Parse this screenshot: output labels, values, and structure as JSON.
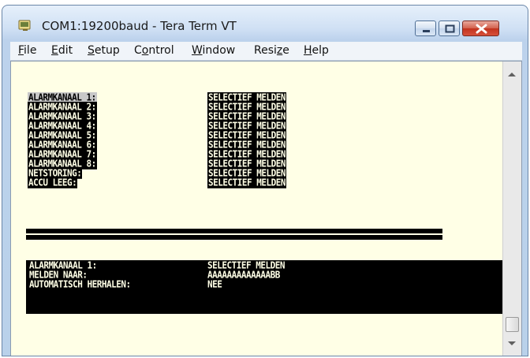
{
  "window": {
    "title": "COM1:19200baud - Tera Term VT",
    "icon": "tera-term-icon",
    "controls": [
      "minimize-icon",
      "maximize-icon",
      "close-icon"
    ]
  },
  "menu": [
    {
      "pre": "",
      "ul": "F",
      "post": "ile"
    },
    {
      "pre": "",
      "ul": "E",
      "post": "dit"
    },
    {
      "pre": "",
      "ul": "S",
      "post": "etup"
    },
    {
      "pre": "C",
      "ul": "o",
      "post": "ntrol"
    },
    {
      "pre": "",
      "ul": "W",
      "post": "indow"
    },
    {
      "pre": "Resi",
      "ul": "z",
      "post": "e"
    },
    {
      "pre": "",
      "ul": "H",
      "post": "elp"
    }
  ],
  "terminal": {
    "list": [
      {
        "label": "ALARMKANAAL 1:",
        "value": "SELECTIEF MELDEN"
      },
      {
        "label": "ALARMKANAAL 2:",
        "value": "SELECTIEF MELDEN"
      },
      {
        "label": "ALARMKANAAL 3:",
        "value": "SELECTIEF MELDEN"
      },
      {
        "label": "ALARMKANAAL 4:",
        "value": "SELECTIEF MELDEN"
      },
      {
        "label": "ALARMKANAAL 5:",
        "value": "SELECTIEF MELDEN"
      },
      {
        "label": "ALARMKANAAL 6:",
        "value": "SELECTIEF MELDEN"
      },
      {
        "label": "ALARMKANAAL 7:",
        "value": "SELECTIEF MELDEN"
      },
      {
        "label": "ALARMKANAAL 8:",
        "value": "SELECTIEF MELDEN"
      },
      {
        "label": "NETSTORING:",
        "value": "SELECTIEF MELDEN"
      },
      {
        "label": "ACCU LEEG:",
        "value": "SELECTIEF MELDEN"
      }
    ],
    "detail": [
      {
        "label": "ALARMKANAAL 1:",
        "value": "SELECTIEF MELDEN"
      },
      {
        "label": "MELDEN NAAR:",
        "value": "AAAAAAAAAAAAABB"
      },
      {
        "label": "AUTOMATISCH HERHALEN:",
        "value": "NEE"
      }
    ]
  },
  "colors": {
    "terminal_bg": "#ffffe6",
    "terminal_fg": "#000000",
    "selection": "#c8c8c8"
  }
}
